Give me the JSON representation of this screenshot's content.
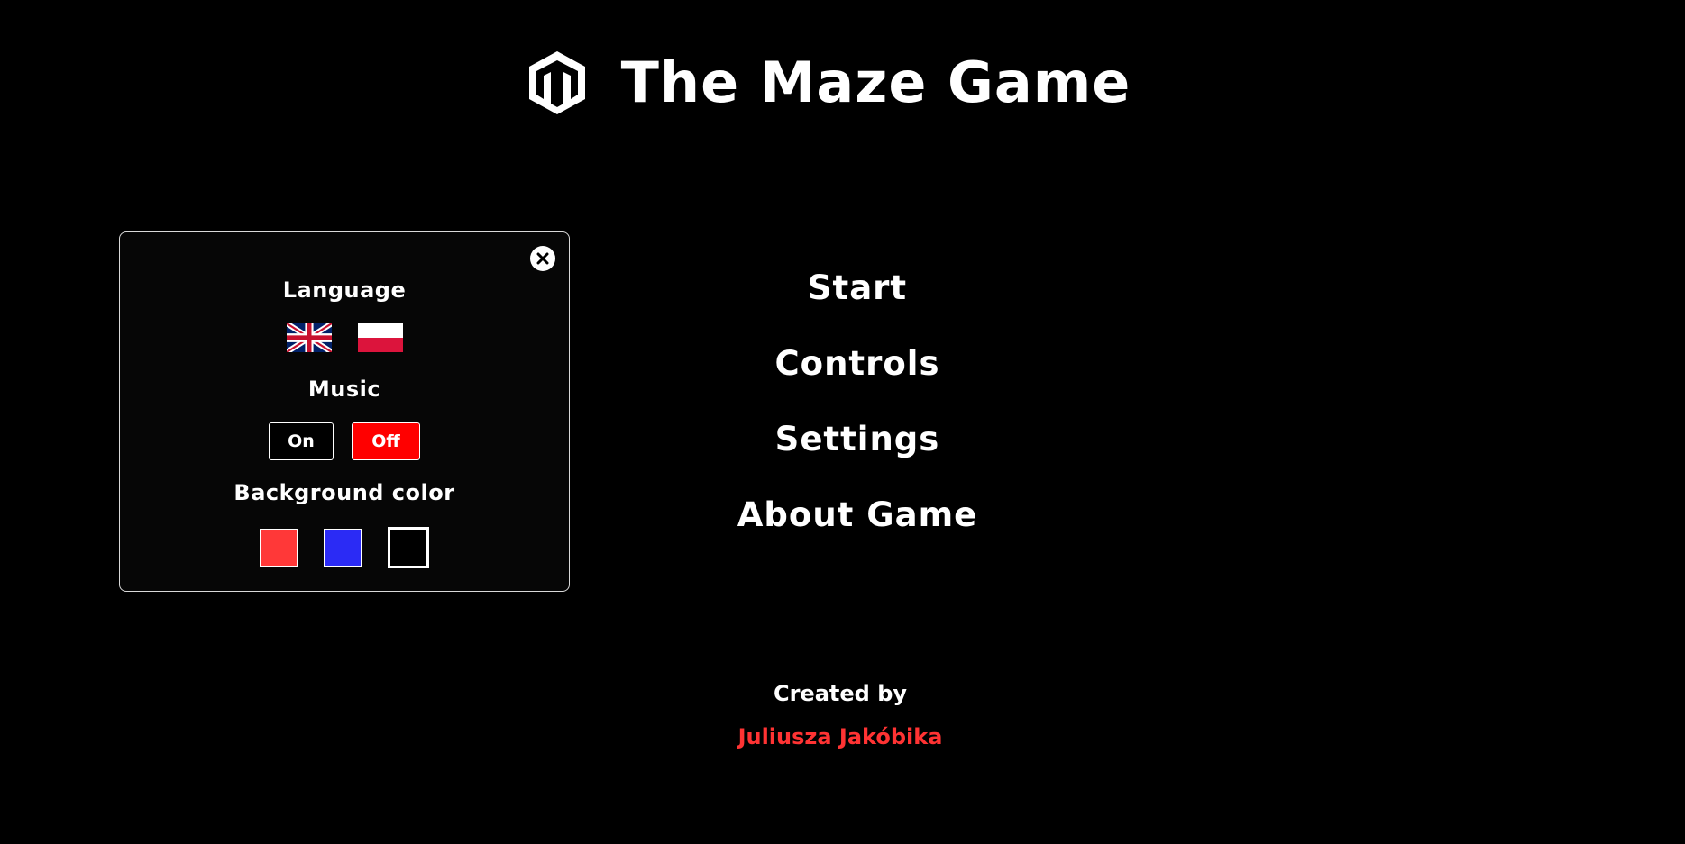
{
  "header": {
    "title": "The Maze Game",
    "logo_icon": "hexagon-m-logo-icon"
  },
  "settings": {
    "close_icon": "close-icon",
    "language_label": "Language",
    "languages": [
      {
        "name": "English",
        "icon": "uk-flag-icon"
      },
      {
        "name": "Polish",
        "icon": "poland-flag-icon"
      }
    ],
    "music_label": "Music",
    "music_on_label": "On",
    "music_off_label": "Off",
    "music_state": "Off",
    "background_label": "Background color",
    "background_colors": [
      "#ff3838",
      "#2b2bf5",
      "#000000"
    ],
    "selected_background": "#000000"
  },
  "menu": {
    "items": [
      {
        "label": "Start"
      },
      {
        "label": "Controls"
      },
      {
        "label": "Settings"
      },
      {
        "label": "About Game"
      }
    ]
  },
  "footer": {
    "created_by_label": "Created by",
    "author_name": "Juliusza Jakóbika"
  },
  "colors": {
    "accent_red": "#ff0000",
    "author_red": "#ff3333",
    "background": "#000000",
    "text": "#ffffff"
  }
}
